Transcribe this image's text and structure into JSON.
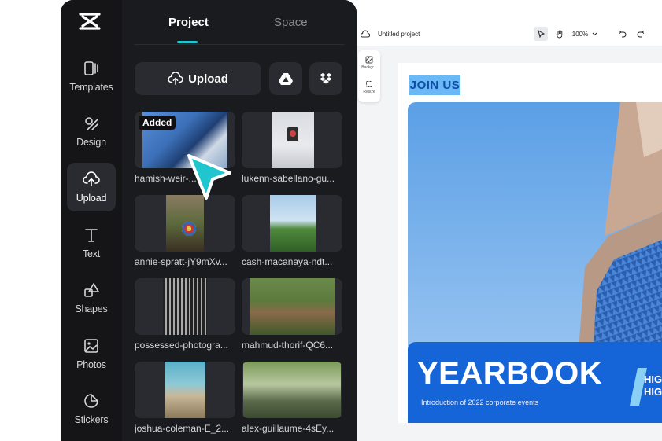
{
  "sidebar": {
    "items": [
      {
        "label": "Templates",
        "icon": "templates-icon"
      },
      {
        "label": "Design",
        "icon": "design-icon"
      },
      {
        "label": "Upload",
        "icon": "upload-cloud-icon"
      },
      {
        "label": "Text",
        "icon": "text-icon"
      },
      {
        "label": "Shapes",
        "icon": "shapes-icon"
      },
      {
        "label": "Photos",
        "icon": "photos-icon"
      },
      {
        "label": "Stickers",
        "icon": "stickers-icon"
      }
    ],
    "active": "Upload"
  },
  "panel": {
    "tabs": [
      {
        "label": "Project"
      },
      {
        "label": "Space"
      }
    ],
    "upload_label": "Upload",
    "added_badge": "Added",
    "files": [
      {
        "name": "hamish-weir-..."
      },
      {
        "name": "lukenn-sabellano-gu..."
      },
      {
        "name": "annie-spratt-jY9mXv..."
      },
      {
        "name": "cash-macanaya-ndt..."
      },
      {
        "name": "possessed-photogra..."
      },
      {
        "name": "mahmud-thorif-QC6..."
      },
      {
        "name": "joshua-coleman-E_2..."
      },
      {
        "name": "alex-guillaume-4sEy..."
      }
    ]
  },
  "canvas": {
    "project_title": "Untitled project",
    "zoom": "100%",
    "side_tools": [
      {
        "label": "Backgr..."
      },
      {
        "label": "Resize"
      }
    ],
    "poster": {
      "join_label": "JOIN US",
      "title": "YEARBOOK",
      "subtitle": "Introduction of 2022 corporate events",
      "side_text_1": "HIG",
      "side_text_2": "HIG"
    }
  },
  "colors": {
    "accent": "#1fc6cd",
    "poster_blue": "#1565d8",
    "join_bg": "#6ab8f5"
  }
}
